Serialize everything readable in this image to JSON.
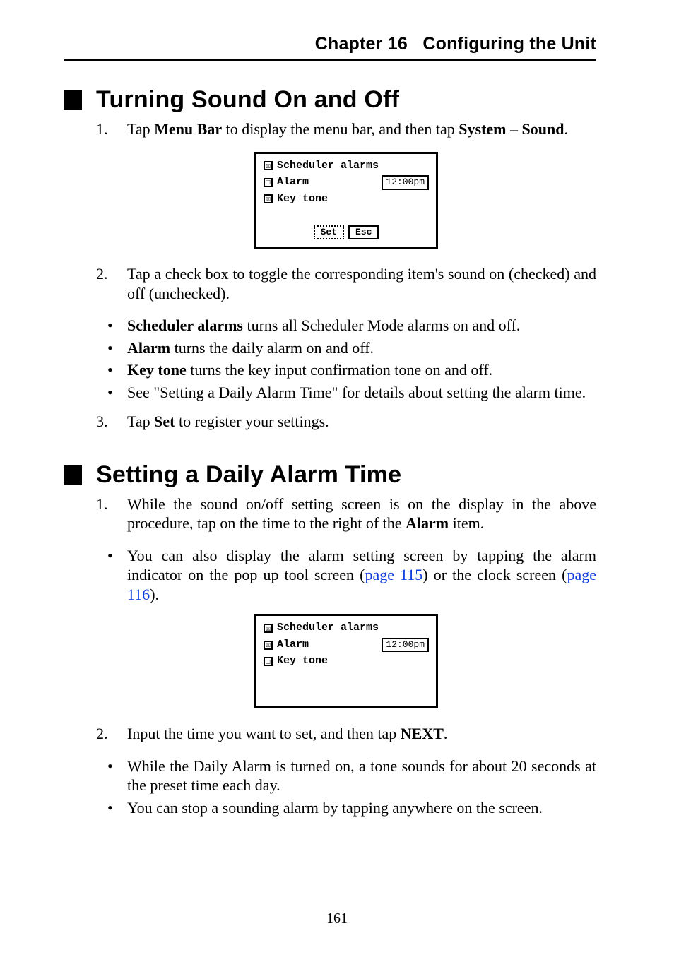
{
  "header": {
    "chapter": "Chapter 16",
    "title": "Configuring the Unit",
    "combined": "Chapter 16 Configuring the Unit"
  },
  "section1": {
    "heading": "Turning Sound On and Off",
    "step1_pre": "Tap ",
    "step1_b1": "Menu Bar",
    "step1_mid": " to display the menu bar, and then tap ",
    "step1_b2": "System",
    "step1_dash": " – ",
    "step1_b3": "Sound",
    "step1_post": ".",
    "fig1": {
      "scheduler_label": "Scheduler alarms",
      "scheduler_checked": "☒",
      "alarm_label": "Alarm",
      "alarm_checked": "☐",
      "time": "12:00pm",
      "keytone_label": "Key tone",
      "keytone_checked": "☒",
      "btn_set": "Set",
      "btn_esc": "Esc"
    },
    "step2": "Tap a check box to toggle the corresponding item's sound on (checked) and off (unchecked).",
    "bul1_b": "Scheduler alarms",
    "bul1_t": " turns all Scheduler Mode alarms on and off.",
    "bul2_b": "Alarm",
    "bul2_t": " turns the daily alarm on and off.",
    "bul3_b": "Key tone",
    "bul3_t": " turns the key input confirmation tone on and off.",
    "bul4": "See \"Setting a Daily Alarm Time\" for details about setting the alarm time.",
    "step3_pre": "Tap ",
    "step3_b1": "Set",
    "step3_post": " to register your settings."
  },
  "section2": {
    "heading": "Setting a Daily Alarm Time",
    "step1_a": "While the sound on/off setting screen is on the display in the above procedure, tap on the time to the right of the ",
    "step1_b": "Alarm",
    "step1_c": " item.",
    "bul1_a": "You can also display the alarm setting screen by tapping the alarm indicator on the pop up tool screen (",
    "bul1_link1": "page 115",
    "bul1_b": ") or the clock screen (",
    "bul1_link2": "page 116",
    "bul1_c": ").",
    "fig2": {
      "scheduler_label": "Scheduler alarms",
      "scheduler_checked": "☒",
      "alarm_label": "Alarm",
      "alarm_checked": "☒",
      "time": "12:00pm",
      "keytone_label": "Key tone",
      "keytone_checked": "☐"
    },
    "step2_a": "Input the time you want to set, and then tap ",
    "step2_b": "NEXT",
    "step2_c": ".",
    "bul2": "While the Daily Alarm is turned on, a tone sounds for about 20 seconds at the preset time each day.",
    "bul3": "You can stop a sounding alarm by tapping anywhere on the screen."
  },
  "page_number": "161"
}
